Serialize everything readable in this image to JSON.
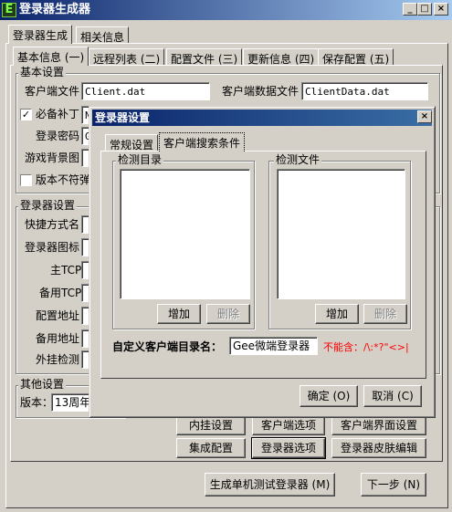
{
  "window": {
    "icon_letter": "E",
    "title": "登录器生成器",
    "buttons": {
      "minimize": "_",
      "maximize": "□",
      "close": "×"
    }
  },
  "main_tabs": [
    "登录器生成",
    "相关信息"
  ],
  "sub_tabs": [
    "基本信息 (一)",
    "远程列表 (二)",
    "配置文件 (三)",
    "更新信息 (四)",
    "保存配置 (五)"
  ],
  "basic": {
    "group_label": "基本设置",
    "client_file_label": "客户端文件",
    "client_file_value": "Client.dat",
    "client_data_label": "客户端数据文件",
    "client_data_value": "ClientData.dat",
    "required_patch_label": "必备补丁",
    "required_patch_checked": true,
    "required_patch_value": "N",
    "password_label": "登录密码",
    "password_value": "G",
    "game_bg_label": "游戏背景图",
    "version_mismatch_label": "版本不符弹",
    "version_mismatch_checked": false
  },
  "launcher": {
    "group_label": "登录器设置",
    "labels": [
      "快捷方式名",
      "登录器图标",
      "主TCP",
      "备用TCP",
      "配置地址",
      "备用地址",
      "外挂检测"
    ]
  },
  "other": {
    "group_label": "其他设置",
    "version_label": "版本：",
    "version_value": "13周年版"
  },
  "bottom_buttons": {
    "plugin": "内挂设置",
    "client_options": "客户端选项",
    "client_ui": "客户端界面设置",
    "integrate": "集成配置",
    "launcher_options": "登录器选项",
    "skin_edit": "登录器皮肤编辑",
    "generate": "生成单机测试登录器 (M)",
    "next": "下一步 (N)"
  },
  "dialog": {
    "title": "登录器设置",
    "close": "×",
    "tabs": [
      "常规设置",
      "客户端搜索条件"
    ],
    "detect_dir": {
      "label": "检测目录",
      "add": "增加",
      "delete": "删除"
    },
    "detect_file": {
      "label": "检测文件",
      "add": "增加",
      "delete": "删除"
    },
    "custom_dir_label": "自定义客户端目录名：",
    "custom_dir_value": "Gee微端登录器",
    "invalid_chars": "不能含：/\\:*?\"<>|",
    "ok": "确定 (O)",
    "cancel": "取消 (C)"
  }
}
